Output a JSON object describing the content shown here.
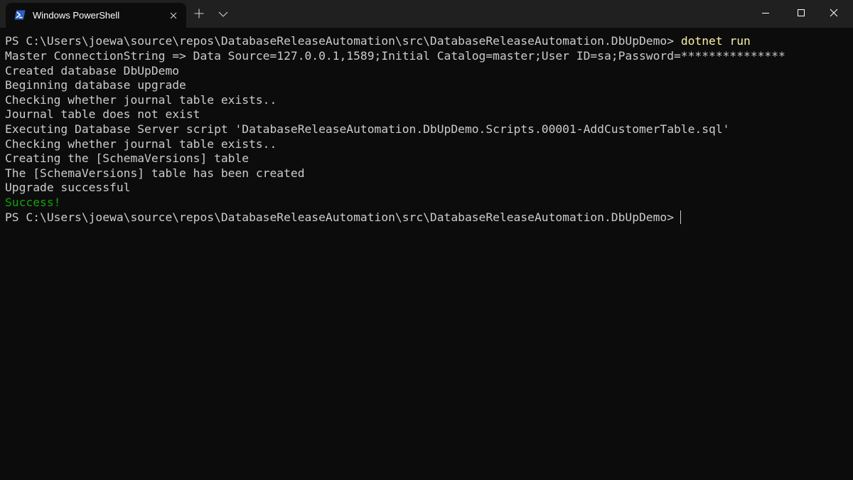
{
  "window": {
    "tab_title": "Windows PowerShell",
    "tab_icon": "powershell-icon",
    "new_tab_icon": "plus-icon",
    "dropdown_icon": "chevron-down-icon",
    "caption_icons": [
      "minimize-icon",
      "maximize-icon",
      "close-icon"
    ]
  },
  "colors": {
    "background": "#0c0c0c",
    "titlebar": "#202020",
    "text": "#cccccc",
    "command": "#f9f1a5",
    "success": "#13a10e",
    "powershell_icon": "#2a5fc4"
  },
  "terminal": {
    "prompt": "PS C:\\Users\\joewa\\source\\repos\\DatabaseReleaseAutomation\\src\\DatabaseReleaseAutomation.DbUpDemo>",
    "command": "dotnet run",
    "output": [
      "Master ConnectionString => Data Source=127.0.0.1,1589;Initial Catalog=master;User ID=sa;Password=***************",
      "Created database DbUpDemo",
      "Beginning database upgrade",
      "Checking whether journal table exists..",
      "Journal table does not exist",
      "Executing Database Server script 'DatabaseReleaseAutomation.DbUpDemo.Scripts.00001-AddCustomerTable.sql'",
      "Checking whether journal table exists..",
      "Creating the [SchemaVersions] table",
      "The [SchemaVersions] table has been created",
      "Upgrade successful"
    ],
    "success_message": "Success!",
    "final_prompt": "PS C:\\Users\\joewa\\source\\repos\\DatabaseReleaseAutomation\\src\\DatabaseReleaseAutomation.DbUpDemo>"
  }
}
